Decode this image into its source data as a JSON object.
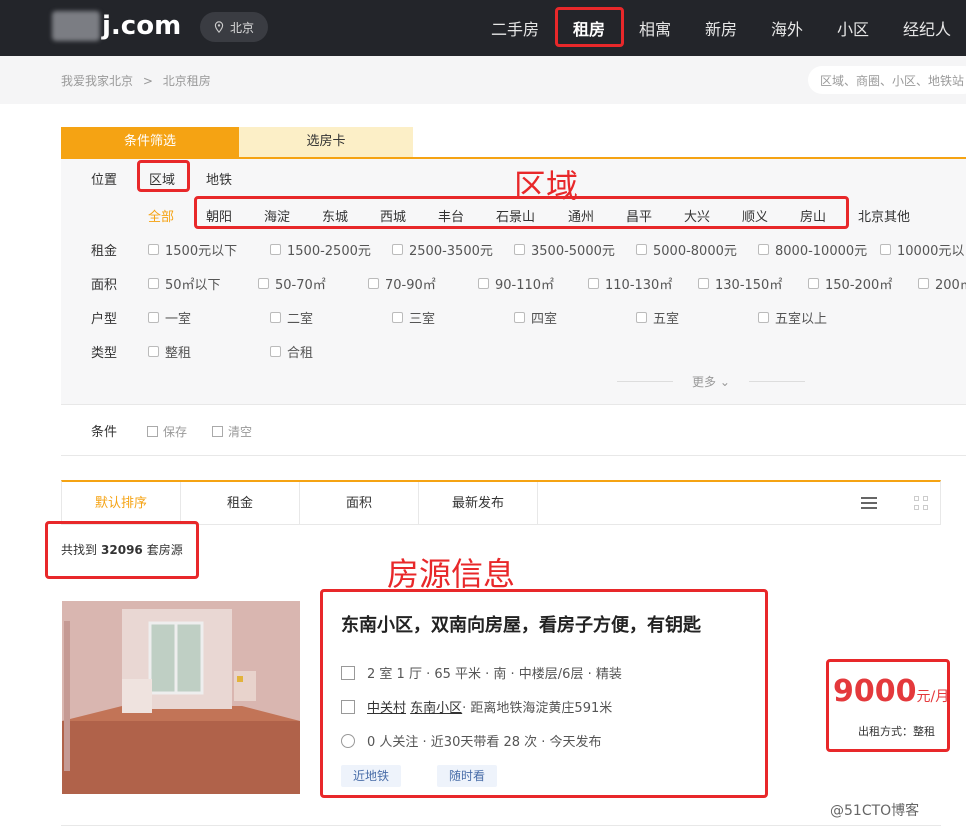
{
  "header": {
    "logo_text": "j.com",
    "city": "北京",
    "nav": [
      "二手房",
      "租房",
      "相寓",
      "新房",
      "海外",
      "小区",
      "经纪人"
    ]
  },
  "breadcrumb": [
    "我爱我家北京",
    ">",
    "北京租房"
  ],
  "search": {
    "placeholder": "区域、商圈、小区、地铁站"
  },
  "filter_tabs": [
    "条件筛选",
    "选房卡"
  ],
  "filter": {
    "position_label": "位置",
    "position_tabs": [
      "区域",
      "地铁"
    ],
    "districts": [
      "全部",
      "朝阳",
      "海淀",
      "东城",
      "西城",
      "丰台",
      "石景山",
      "通州",
      "昌平",
      "大兴",
      "顺义",
      "房山",
      "北京其他"
    ],
    "rent_label": "租金",
    "rent_options": [
      "1500元以下",
      "1500-2500元",
      "2500-3500元",
      "3500-5000元",
      "5000-8000元",
      "8000-10000元",
      "10000元以"
    ],
    "area_label": "面积",
    "area_options": [
      "50㎡以下",
      "50-70㎡",
      "70-90㎡",
      "90-110㎡",
      "110-130㎡",
      "130-150㎡",
      "150-200㎡",
      "200㎡"
    ],
    "layout_label": "户型",
    "layout_options": [
      "一室",
      "二室",
      "三室",
      "四室",
      "五室",
      "五室以上"
    ],
    "type_label": "类型",
    "type_options": [
      "整租",
      "合租"
    ],
    "more": "更多",
    "condition_label": "条件",
    "save": "保存",
    "clear": "清空"
  },
  "sort": [
    "默认排序",
    "租金",
    "面积",
    "最新发布"
  ],
  "count": {
    "prefix": "共找到",
    "value": "32096",
    "suffix": "套房源"
  },
  "annotations": {
    "region": "区域",
    "listing": "房源信息"
  },
  "listing": {
    "title": "东南小区，双南向房屋，看房子方便，有钥匙",
    "line1": "2 室 1 厅 · 65 平米 · 南 · 中楼层/6层 · 精装",
    "loc_a": "中关村",
    "loc_b": "东南小区",
    "line2_rest": " · 距离地铁海淀黄庄591米",
    "line3": "0 人关注 · 近30天带看 28 次 · 今天发布",
    "tags": [
      "近地铁",
      "随时看"
    ],
    "price": "9000",
    "price_unit": "元/月",
    "rent_way": "出租方式：整租"
  },
  "watermark": "@51CTO博客",
  "colors": {
    "accent": "#f5a313",
    "annotation_red": "#e8282a",
    "price_red": "#e4393c"
  }
}
